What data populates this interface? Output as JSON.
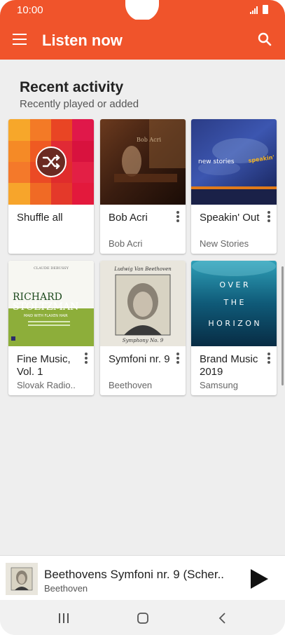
{
  "status": {
    "time": "10:00"
  },
  "appbar": {
    "title": "Listen now"
  },
  "section": {
    "title": "Recent activity",
    "subtitle": "Recently played or added"
  },
  "cards": [
    {
      "title": "Shuffle all",
      "subtitle": ""
    },
    {
      "title": "Bob Acri",
      "subtitle": "Bob Acri"
    },
    {
      "title": "Speakin' Out",
      "subtitle": "New Stories"
    },
    {
      "title": "Fine Music, Vol. 1",
      "subtitle": "Slovak Radio.."
    },
    {
      "title": "Symfoni nr. 9",
      "subtitle": "Beethoven"
    },
    {
      "title": "Brand Music 2019",
      "subtitle": "Samsung"
    }
  ],
  "art_text": {
    "speakin": "new stories",
    "fine_top": "CLAUDE DEBUSSY",
    "fine_name1": "RICHARD",
    "fine_name2": "STOLTZMAN",
    "fine_sub": "MAID WITH FLAXEN HAIR",
    "beethoven_top": "Ludwig Van Beethoven",
    "beethoven_bottom": "Symphony No. 9",
    "horizon1": "O V E R",
    "horizon2": "T H E",
    "horizon3": "H O R I Z O N"
  },
  "player": {
    "title": "Beethovens Symfoni nr. 9 (Scher..",
    "artist": "Beethoven"
  },
  "colors": {
    "accent": "#f0542b"
  }
}
